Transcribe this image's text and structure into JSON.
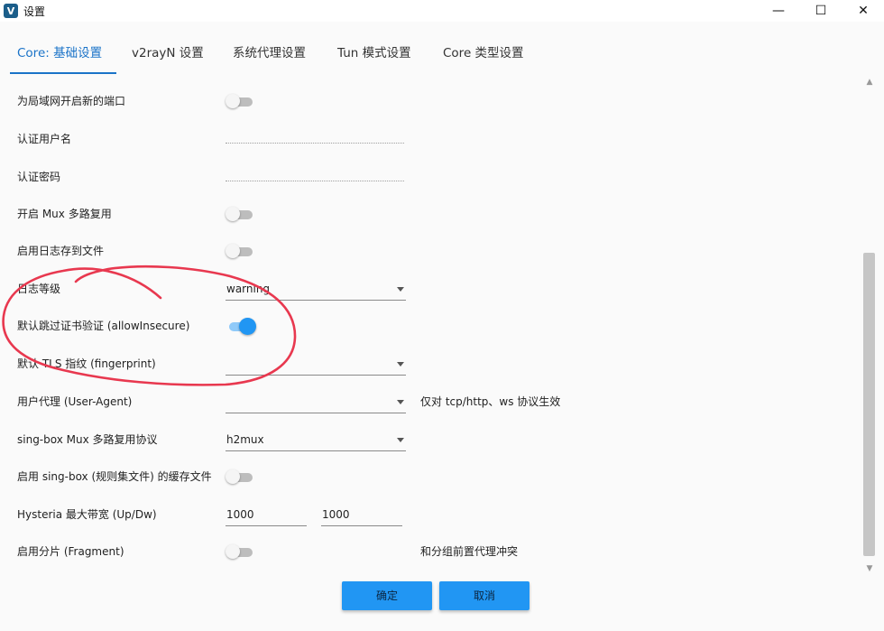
{
  "window": {
    "title": "设置",
    "app_icon": "V",
    "controls": {
      "minimize": "—",
      "maximize": "☐",
      "close": "✕"
    }
  },
  "tabs": [
    {
      "label": "Core: 基础设置",
      "active": true
    },
    {
      "label": "v2rayN 设置",
      "active": false
    },
    {
      "label": "系统代理设置",
      "active": false
    },
    {
      "label": "Tun 模式设置",
      "active": false
    },
    {
      "label": "Core 类型设置",
      "active": false
    }
  ],
  "settings": {
    "lan_new_port": {
      "label": "为局域网开启新的端口",
      "enabled": false
    },
    "auth_user": {
      "label": "认证用户名",
      "value": ""
    },
    "auth_pass": {
      "label": "认证密码",
      "value": ""
    },
    "mux": {
      "label": "开启 Mux 多路复用",
      "enabled": false
    },
    "log_file": {
      "label": "启用日志存到文件",
      "enabled": false
    },
    "log_level": {
      "label": "日志等级",
      "value": "warning"
    },
    "allow_insecure": {
      "label": "默认跳过证书验证 (allowInsecure)",
      "enabled": true
    },
    "tls_fingerprint": {
      "label": "默认 TLS 指纹 (fingerprint)",
      "value": ""
    },
    "user_agent": {
      "label": "用户代理 (User-Agent)",
      "value": "",
      "note": "仅对 tcp/http、ws 协议生效"
    },
    "singbox_mux": {
      "label": "sing-box Mux 多路复用协议",
      "value": "h2mux"
    },
    "singbox_cache": {
      "label": "启用 sing-box (规则集文件) 的缓存文件",
      "enabled": false
    },
    "hysteria_bw": {
      "label": "Hysteria 最大带宽 (Up/Dw)",
      "up": "1000",
      "down": "1000"
    },
    "fragment": {
      "label": "启用分片 (Fragment)",
      "enabled": false,
      "note": "和分组前置代理冲突"
    }
  },
  "buttons": {
    "ok": "确定",
    "cancel": "取消"
  },
  "colors": {
    "accent": "#2196f3",
    "tab_active": "#1a73c8",
    "annotation": "#e8384f"
  }
}
